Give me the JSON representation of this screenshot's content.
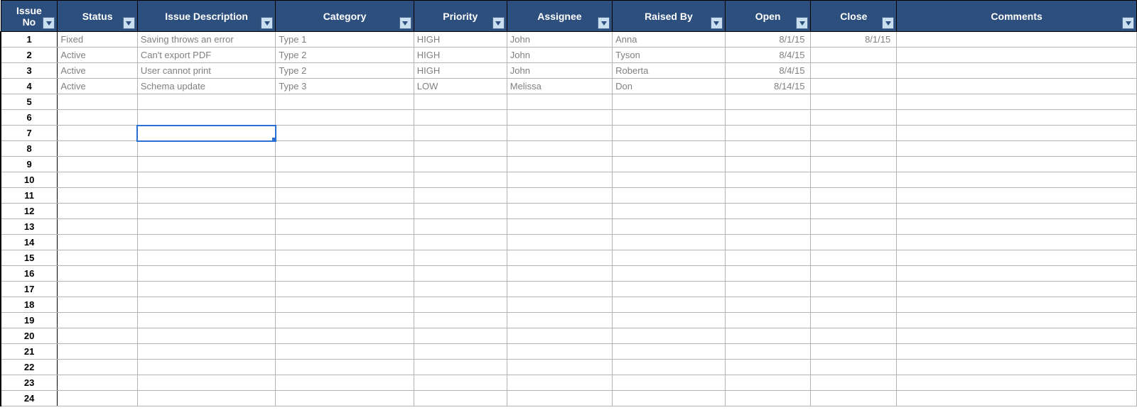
{
  "columns": [
    {
      "key": "issue_no",
      "label": "Issue No"
    },
    {
      "key": "status",
      "label": "Status"
    },
    {
      "key": "description",
      "label": "Issue Description"
    },
    {
      "key": "category",
      "label": "Category"
    },
    {
      "key": "priority",
      "label": "Priority"
    },
    {
      "key": "assignee",
      "label": "Assignee"
    },
    {
      "key": "raised_by",
      "label": "Raised By"
    },
    {
      "key": "open",
      "label": "Open"
    },
    {
      "key": "close",
      "label": "Close"
    },
    {
      "key": "comments",
      "label": "Comments"
    }
  ],
  "rows": [
    {
      "issue_no": "1",
      "status": "Fixed",
      "description": "Saving throws an error",
      "category": "Type 1",
      "priority": "HIGH",
      "assignee": "John",
      "raised_by": "Anna",
      "open": "8/1/15",
      "close": "8/1/15",
      "comments": ""
    },
    {
      "issue_no": "2",
      "status": "Active",
      "description": "Can't export PDF",
      "category": "Type 2",
      "priority": "HIGH",
      "assignee": "John",
      "raised_by": "Tyson",
      "open": "8/4/15",
      "close": "",
      "comments": ""
    },
    {
      "issue_no": "3",
      "status": "Active",
      "description": "User cannot print",
      "category": "Type 2",
      "priority": "HIGH",
      "assignee": "John",
      "raised_by": "Roberta",
      "open": "8/4/15",
      "close": "",
      "comments": ""
    },
    {
      "issue_no": "4",
      "status": "Active",
      "description": "Schema update",
      "category": "Type 3",
      "priority": "LOW",
      "assignee": "Melissa",
      "raised_by": "Don",
      "open": "8/14/15",
      "close": "",
      "comments": ""
    },
    {
      "issue_no": "5",
      "status": "",
      "description": "",
      "category": "",
      "priority": "",
      "assignee": "",
      "raised_by": "",
      "open": "",
      "close": "",
      "comments": ""
    },
    {
      "issue_no": "6",
      "status": "",
      "description": "",
      "category": "",
      "priority": "",
      "assignee": "",
      "raised_by": "",
      "open": "",
      "close": "",
      "comments": ""
    },
    {
      "issue_no": "7",
      "status": "",
      "description": "",
      "category": "",
      "priority": "",
      "assignee": "",
      "raised_by": "",
      "open": "",
      "close": "",
      "comments": ""
    },
    {
      "issue_no": "8",
      "status": "",
      "description": "",
      "category": "",
      "priority": "",
      "assignee": "",
      "raised_by": "",
      "open": "",
      "close": "",
      "comments": ""
    },
    {
      "issue_no": "9",
      "status": "",
      "description": "",
      "category": "",
      "priority": "",
      "assignee": "",
      "raised_by": "",
      "open": "",
      "close": "",
      "comments": ""
    },
    {
      "issue_no": "10",
      "status": "",
      "description": "",
      "category": "",
      "priority": "",
      "assignee": "",
      "raised_by": "",
      "open": "",
      "close": "",
      "comments": ""
    },
    {
      "issue_no": "11",
      "status": "",
      "description": "",
      "category": "",
      "priority": "",
      "assignee": "",
      "raised_by": "",
      "open": "",
      "close": "",
      "comments": ""
    },
    {
      "issue_no": "12",
      "status": "",
      "description": "",
      "category": "",
      "priority": "",
      "assignee": "",
      "raised_by": "",
      "open": "",
      "close": "",
      "comments": ""
    },
    {
      "issue_no": "13",
      "status": "",
      "description": "",
      "category": "",
      "priority": "",
      "assignee": "",
      "raised_by": "",
      "open": "",
      "close": "",
      "comments": ""
    },
    {
      "issue_no": "14",
      "status": "",
      "description": "",
      "category": "",
      "priority": "",
      "assignee": "",
      "raised_by": "",
      "open": "",
      "close": "",
      "comments": ""
    },
    {
      "issue_no": "15",
      "status": "",
      "description": "",
      "category": "",
      "priority": "",
      "assignee": "",
      "raised_by": "",
      "open": "",
      "close": "",
      "comments": ""
    },
    {
      "issue_no": "16",
      "status": "",
      "description": "",
      "category": "",
      "priority": "",
      "assignee": "",
      "raised_by": "",
      "open": "",
      "close": "",
      "comments": ""
    },
    {
      "issue_no": "17",
      "status": "",
      "description": "",
      "category": "",
      "priority": "",
      "assignee": "",
      "raised_by": "",
      "open": "",
      "close": "",
      "comments": ""
    },
    {
      "issue_no": "18",
      "status": "",
      "description": "",
      "category": "",
      "priority": "",
      "assignee": "",
      "raised_by": "",
      "open": "",
      "close": "",
      "comments": ""
    },
    {
      "issue_no": "19",
      "status": "",
      "description": "",
      "category": "",
      "priority": "",
      "assignee": "",
      "raised_by": "",
      "open": "",
      "close": "",
      "comments": ""
    },
    {
      "issue_no": "20",
      "status": "",
      "description": "",
      "category": "",
      "priority": "",
      "assignee": "",
      "raised_by": "",
      "open": "",
      "close": "",
      "comments": ""
    },
    {
      "issue_no": "21",
      "status": "",
      "description": "",
      "category": "",
      "priority": "",
      "assignee": "",
      "raised_by": "",
      "open": "",
      "close": "",
      "comments": ""
    },
    {
      "issue_no": "22",
      "status": "",
      "description": "",
      "category": "",
      "priority": "",
      "assignee": "",
      "raised_by": "",
      "open": "",
      "close": "",
      "comments": ""
    },
    {
      "issue_no": "23",
      "status": "",
      "description": "",
      "category": "",
      "priority": "",
      "assignee": "",
      "raised_by": "",
      "open": "",
      "close": "",
      "comments": ""
    },
    {
      "issue_no": "24",
      "status": "",
      "description": "",
      "category": "",
      "priority": "",
      "assignee": "",
      "raised_by": "",
      "open": "",
      "close": "",
      "comments": ""
    }
  ],
  "selection": {
    "row": 6,
    "col": "description"
  }
}
